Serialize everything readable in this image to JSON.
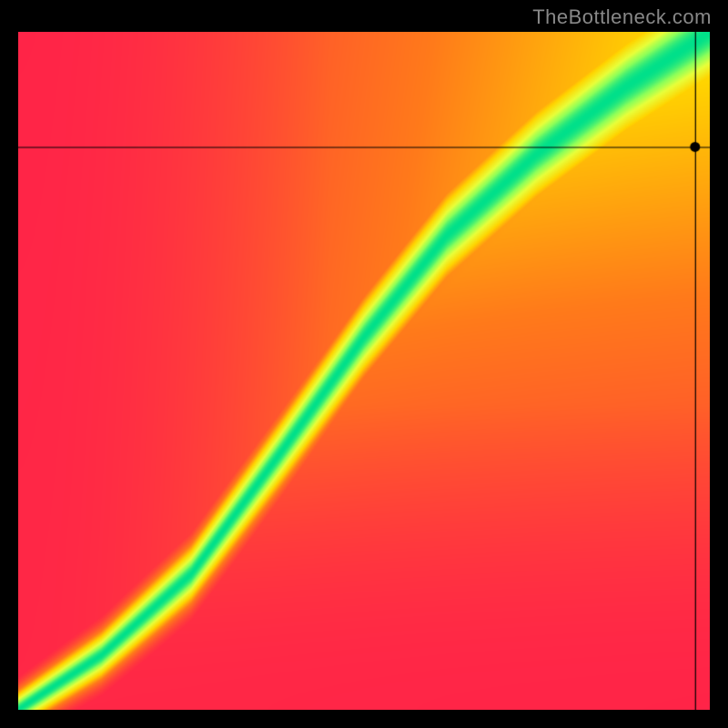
{
  "attribution": "TheBottleneck.com",
  "chart_data": {
    "type": "heatmap",
    "title": "",
    "xlabel": "",
    "ylabel": "",
    "xlim": [
      0,
      100
    ],
    "ylim": [
      0,
      100
    ],
    "crosshair": {
      "x": 98,
      "y": 83
    },
    "color_stops": [
      {
        "t": 0.0,
        "color": "#ff1a4d"
      },
      {
        "t": 0.35,
        "color": "#ff7a1a"
      },
      {
        "t": 0.55,
        "color": "#ffd400"
      },
      {
        "t": 0.75,
        "color": "#e8ff3a"
      },
      {
        "t": 0.88,
        "color": "#8cff5a"
      },
      {
        "t": 1.0,
        "color": "#00e08a"
      }
    ],
    "ridge": {
      "control_points": [
        {
          "x": 0,
          "y": 0
        },
        {
          "x": 12,
          "y": 8
        },
        {
          "x": 25,
          "y": 20
        },
        {
          "x": 38,
          "y": 38
        },
        {
          "x": 50,
          "y": 55
        },
        {
          "x": 62,
          "y": 70
        },
        {
          "x": 75,
          "y": 82
        },
        {
          "x": 88,
          "y": 92
        },
        {
          "x": 100,
          "y": 100
        }
      ],
      "sigma_bottom": 2.0,
      "sigma_top": 6.0
    }
  }
}
